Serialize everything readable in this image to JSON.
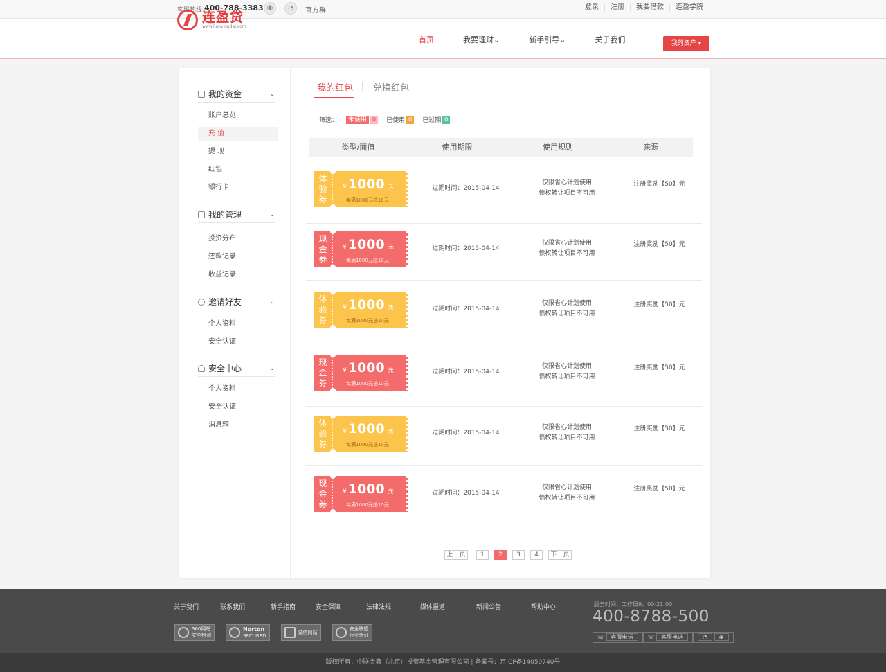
{
  "topbar": {
    "hotline_label": "客服热线",
    "hotline_number": "400-788-3383",
    "weibo_icon": "weibo-icon",
    "wechat_icon": "wechat-icon",
    "group_label": "官方群",
    "links": [
      "登录",
      "注册",
      "我要借款",
      "连盈学院"
    ]
  },
  "header": {
    "logo_cn": "连盈贷",
    "logo_en": "www.lianyingdai.com",
    "nav": [
      "首页",
      "我要理财⌄",
      "新手引导⌄",
      "关于我们"
    ],
    "assets_button": "我的资产 ▾"
  },
  "sidebar": {
    "groups": [
      {
        "title": "我的资金",
        "items": [
          "账户总览",
          "充 值",
          "提 现",
          "红包",
          "银行卡"
        ]
      },
      {
        "title": "我的管理",
        "items": [
          "投资分布",
          "还款记录",
          "收益记录"
        ]
      },
      {
        "title": "邀请好友",
        "items": [
          "个人资料",
          "安全认证"
        ]
      },
      {
        "title": "安全中心",
        "items": [
          "个人资料",
          "安全认证",
          "消息箱"
        ]
      }
    ],
    "chevron": "⌄"
  },
  "tabs": {
    "active": "我的红包",
    "other": "兑换红包"
  },
  "filter": {
    "label": "筛选：",
    "options": [
      {
        "label": "未使用",
        "count": "0"
      },
      {
        "label": "已使用",
        "count": "0"
      },
      {
        "label": "已过期",
        "count": "0"
      }
    ]
  },
  "table": {
    "headers": [
      "类型/面值",
      "使用期限",
      "使用规则",
      "来源"
    ],
    "rows": [
      {
        "type": "体验券",
        "kind": "exp",
        "yen": "¥",
        "amount": "1000",
        "unit": "元",
        "condition": "每满1000元抵10元",
        "expiry": "过期时间：2015-04-14",
        "rule1": "仅限省心计划使用",
        "rule2": "债权转让项目不可用",
        "source": "注册奖励【50】元"
      },
      {
        "type": "现金券",
        "kind": "cash",
        "yen": "¥",
        "amount": "1000",
        "unit": "元",
        "condition": "每满1000元抵10元",
        "expiry": "过期时间：2015-04-14",
        "rule1": "仅限省心计划使用",
        "rule2": "债权转让项目不可用",
        "source": "注册奖励【50】元"
      },
      {
        "type": "体验券",
        "kind": "exp",
        "yen": "¥",
        "amount": "1000",
        "unit": "元",
        "condition": "每满1000元抵10元",
        "expiry": "过期时间：2015-04-14",
        "rule1": "仅限省心计划使用",
        "rule2": "债权转让项目不可用",
        "source": "注册奖励【50】元"
      },
      {
        "type": "现金券",
        "kind": "cash",
        "yen": "¥",
        "amount": "1000",
        "unit": "元",
        "condition": "每满1000元抵10元",
        "expiry": "过期时间：2015-04-14",
        "rule1": "仅限省心计划使用",
        "rule2": "债权转让项目不可用",
        "source": "注册奖励【50】元"
      },
      {
        "type": "体验券",
        "kind": "exp",
        "yen": "¥",
        "amount": "1000",
        "unit": "元",
        "condition": "每满1000元抵10元",
        "expiry": "过期时间：2015-04-14",
        "rule1": "仅限省心计划使用",
        "rule2": "债权转让项目不可用",
        "source": "注册奖励【50】元"
      },
      {
        "type": "现金券",
        "kind": "cash",
        "yen": "¥",
        "amount": "1000",
        "unit": "元",
        "condition": "每满1000元抵10元",
        "expiry": "过期时间：2015-04-14",
        "rule1": "仅限省心计划使用",
        "rule2": "债权转让项目不可用",
        "source": "注册奖励【50】元"
      }
    ]
  },
  "pager": {
    "prev": "上一页",
    "pages": [
      "1",
      "2",
      "3",
      "4"
    ],
    "current": "2",
    "next": "下一页"
  },
  "footer": {
    "links": [
      "关于我们",
      "联系我们",
      "新手指南",
      "安全保障",
      "法律法规",
      "媒体报道",
      "新闻公告",
      "帮助中心"
    ],
    "badges": [
      [
        "360网站",
        "安全检测"
      ],
      [
        "Norton",
        "SECURED"
      ],
      [
        "诚信网站",
        ""
      ],
      [
        "安全联盟",
        "行业验证"
      ]
    ],
    "service_time": "服务时间：工作日9：00-21:00",
    "tel": "400-8788-500",
    "buttons": [
      "客服电话",
      "客服电话"
    ],
    "copyright": "版权所有：中联金典（北京）投资基金管理有限公司  |  备案号：京ICP备14059740号"
  },
  "colors": {
    "accent": "#e64545",
    "experience": "#fcc44b",
    "cash": "#f46b6b"
  }
}
